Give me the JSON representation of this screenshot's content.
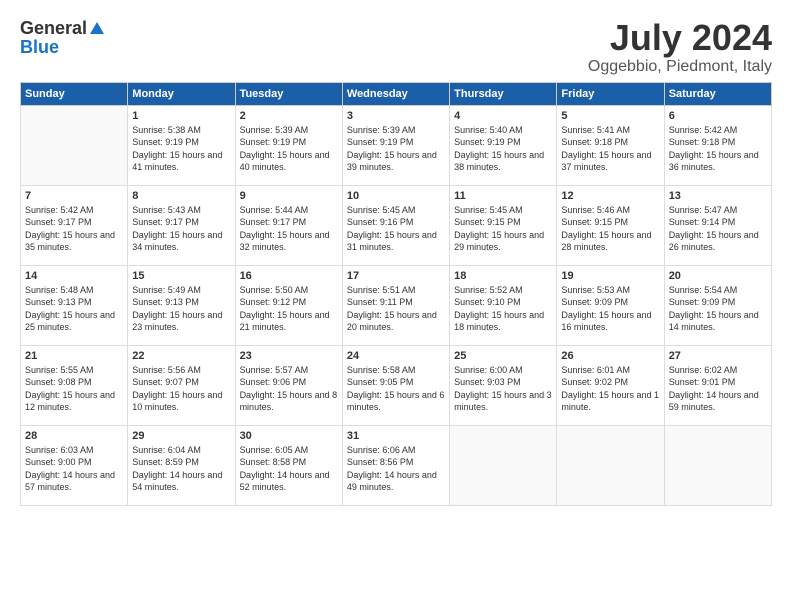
{
  "header": {
    "logo_general": "General",
    "logo_blue": "Blue",
    "month_year": "July 2024",
    "location": "Oggebbio, Piedmont, Italy"
  },
  "days_of_week": [
    "Sunday",
    "Monday",
    "Tuesday",
    "Wednesday",
    "Thursday",
    "Friday",
    "Saturday"
  ],
  "weeks": [
    [
      {
        "day": "",
        "empty": true
      },
      {
        "day": "1",
        "sunrise": "Sunrise: 5:38 AM",
        "sunset": "Sunset: 9:19 PM",
        "daylight": "Daylight: 15 hours and 41 minutes."
      },
      {
        "day": "2",
        "sunrise": "Sunrise: 5:39 AM",
        "sunset": "Sunset: 9:19 PM",
        "daylight": "Daylight: 15 hours and 40 minutes."
      },
      {
        "day": "3",
        "sunrise": "Sunrise: 5:39 AM",
        "sunset": "Sunset: 9:19 PM",
        "daylight": "Daylight: 15 hours and 39 minutes."
      },
      {
        "day": "4",
        "sunrise": "Sunrise: 5:40 AM",
        "sunset": "Sunset: 9:19 PM",
        "daylight": "Daylight: 15 hours and 38 minutes."
      },
      {
        "day": "5",
        "sunrise": "Sunrise: 5:41 AM",
        "sunset": "Sunset: 9:18 PM",
        "daylight": "Daylight: 15 hours and 37 minutes."
      },
      {
        "day": "6",
        "sunrise": "Sunrise: 5:42 AM",
        "sunset": "Sunset: 9:18 PM",
        "daylight": "Daylight: 15 hours and 36 minutes."
      }
    ],
    [
      {
        "day": "7",
        "sunrise": "Sunrise: 5:42 AM",
        "sunset": "Sunset: 9:17 PM",
        "daylight": "Daylight: 15 hours and 35 minutes."
      },
      {
        "day": "8",
        "sunrise": "Sunrise: 5:43 AM",
        "sunset": "Sunset: 9:17 PM",
        "daylight": "Daylight: 15 hours and 34 minutes."
      },
      {
        "day": "9",
        "sunrise": "Sunrise: 5:44 AM",
        "sunset": "Sunset: 9:17 PM",
        "daylight": "Daylight: 15 hours and 32 minutes."
      },
      {
        "day": "10",
        "sunrise": "Sunrise: 5:45 AM",
        "sunset": "Sunset: 9:16 PM",
        "daylight": "Daylight: 15 hours and 31 minutes."
      },
      {
        "day": "11",
        "sunrise": "Sunrise: 5:45 AM",
        "sunset": "Sunset: 9:15 PM",
        "daylight": "Daylight: 15 hours and 29 minutes."
      },
      {
        "day": "12",
        "sunrise": "Sunrise: 5:46 AM",
        "sunset": "Sunset: 9:15 PM",
        "daylight": "Daylight: 15 hours and 28 minutes."
      },
      {
        "day": "13",
        "sunrise": "Sunrise: 5:47 AM",
        "sunset": "Sunset: 9:14 PM",
        "daylight": "Daylight: 15 hours and 26 minutes."
      }
    ],
    [
      {
        "day": "14",
        "sunrise": "Sunrise: 5:48 AM",
        "sunset": "Sunset: 9:13 PM",
        "daylight": "Daylight: 15 hours and 25 minutes."
      },
      {
        "day": "15",
        "sunrise": "Sunrise: 5:49 AM",
        "sunset": "Sunset: 9:13 PM",
        "daylight": "Daylight: 15 hours and 23 minutes."
      },
      {
        "day": "16",
        "sunrise": "Sunrise: 5:50 AM",
        "sunset": "Sunset: 9:12 PM",
        "daylight": "Daylight: 15 hours and 21 minutes."
      },
      {
        "day": "17",
        "sunrise": "Sunrise: 5:51 AM",
        "sunset": "Sunset: 9:11 PM",
        "daylight": "Daylight: 15 hours and 20 minutes."
      },
      {
        "day": "18",
        "sunrise": "Sunrise: 5:52 AM",
        "sunset": "Sunset: 9:10 PM",
        "daylight": "Daylight: 15 hours and 18 minutes."
      },
      {
        "day": "19",
        "sunrise": "Sunrise: 5:53 AM",
        "sunset": "Sunset: 9:09 PM",
        "daylight": "Daylight: 15 hours and 16 minutes."
      },
      {
        "day": "20",
        "sunrise": "Sunrise: 5:54 AM",
        "sunset": "Sunset: 9:09 PM",
        "daylight": "Daylight: 15 hours and 14 minutes."
      }
    ],
    [
      {
        "day": "21",
        "sunrise": "Sunrise: 5:55 AM",
        "sunset": "Sunset: 9:08 PM",
        "daylight": "Daylight: 15 hours and 12 minutes."
      },
      {
        "day": "22",
        "sunrise": "Sunrise: 5:56 AM",
        "sunset": "Sunset: 9:07 PM",
        "daylight": "Daylight: 15 hours and 10 minutes."
      },
      {
        "day": "23",
        "sunrise": "Sunrise: 5:57 AM",
        "sunset": "Sunset: 9:06 PM",
        "daylight": "Daylight: 15 hours and 8 minutes."
      },
      {
        "day": "24",
        "sunrise": "Sunrise: 5:58 AM",
        "sunset": "Sunset: 9:05 PM",
        "daylight": "Daylight: 15 hours and 6 minutes."
      },
      {
        "day": "25",
        "sunrise": "Sunrise: 6:00 AM",
        "sunset": "Sunset: 9:03 PM",
        "daylight": "Daylight: 15 hours and 3 minutes."
      },
      {
        "day": "26",
        "sunrise": "Sunrise: 6:01 AM",
        "sunset": "Sunset: 9:02 PM",
        "daylight": "Daylight: 15 hours and 1 minute."
      },
      {
        "day": "27",
        "sunrise": "Sunrise: 6:02 AM",
        "sunset": "Sunset: 9:01 PM",
        "daylight": "Daylight: 14 hours and 59 minutes."
      }
    ],
    [
      {
        "day": "28",
        "sunrise": "Sunrise: 6:03 AM",
        "sunset": "Sunset: 9:00 PM",
        "daylight": "Daylight: 14 hours and 57 minutes."
      },
      {
        "day": "29",
        "sunrise": "Sunrise: 6:04 AM",
        "sunset": "Sunset: 8:59 PM",
        "daylight": "Daylight: 14 hours and 54 minutes."
      },
      {
        "day": "30",
        "sunrise": "Sunrise: 6:05 AM",
        "sunset": "Sunset: 8:58 PM",
        "daylight": "Daylight: 14 hours and 52 minutes."
      },
      {
        "day": "31",
        "sunrise": "Sunrise: 6:06 AM",
        "sunset": "Sunset: 8:56 PM",
        "daylight": "Daylight: 14 hours and 49 minutes."
      },
      {
        "day": "",
        "empty": true
      },
      {
        "day": "",
        "empty": true
      },
      {
        "day": "",
        "empty": true
      }
    ]
  ]
}
